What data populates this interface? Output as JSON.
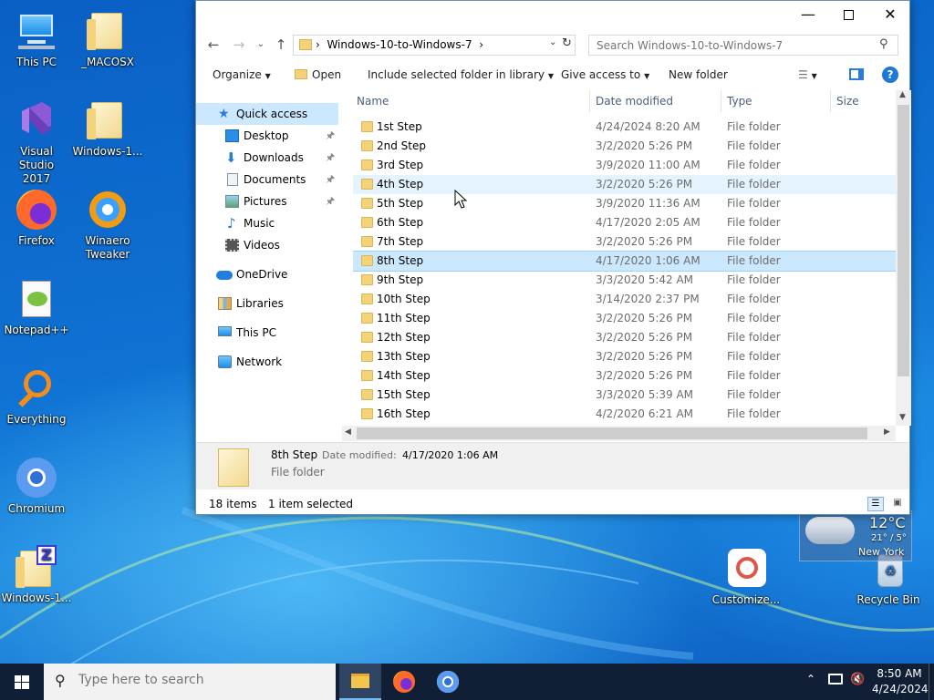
{
  "desktop": {
    "icons": [
      {
        "label": "This PC"
      },
      {
        "label": "_MACOSX"
      },
      {
        "label": "Visual Studio 2017"
      },
      {
        "label": "Windows-1..."
      },
      {
        "label": "Firefox"
      },
      {
        "label": "Winaero Tweaker"
      },
      {
        "label": "Notepad++"
      },
      {
        "label": "Everything"
      },
      {
        "label": "Chromium"
      },
      {
        "label": "Windows-1..."
      },
      {
        "label": "Customize..."
      },
      {
        "label": "Recycle Bin"
      }
    ],
    "weather": {
      "temp": "12°C",
      "range": "21° / 5°",
      "city": "New York"
    }
  },
  "explorer": {
    "address": {
      "path": "Windows-10-to-Windows-7",
      "search_placeholder": "Search Windows-10-to-Windows-7"
    },
    "toolbar": {
      "organize": "Organize",
      "open": "Open",
      "include": "Include selected folder in library",
      "share": "Give access to",
      "new_folder": "New folder"
    },
    "nav": {
      "quick_access": "Quick access",
      "desktop": "Desktop",
      "downloads": "Downloads",
      "documents": "Documents",
      "pictures": "Pictures",
      "music": "Music",
      "videos": "Videos",
      "onedrive": "OneDrive",
      "libraries": "Libraries",
      "this_pc": "This PC",
      "network": "Network"
    },
    "columns": {
      "name": "Name",
      "date": "Date modified",
      "type": "Type",
      "size": "Size"
    },
    "rows": [
      {
        "name": "1st Step",
        "date": "4/24/2024 8:20 AM",
        "type": "File folder"
      },
      {
        "name": "2nd Step",
        "date": "3/2/2020 5:26 PM",
        "type": "File folder"
      },
      {
        "name": "3rd Step",
        "date": "3/9/2020 11:00 AM",
        "type": "File folder"
      },
      {
        "name": "4th Step",
        "date": "3/2/2020 5:26 PM",
        "type": "File folder"
      },
      {
        "name": "5th Step",
        "date": "3/9/2020 11:36 AM",
        "type": "File folder"
      },
      {
        "name": "6th Step",
        "date": "4/17/2020 2:05 AM",
        "type": "File folder"
      },
      {
        "name": "7th Step",
        "date": "3/2/2020 5:26 PM",
        "type": "File folder"
      },
      {
        "name": "8th Step",
        "date": "4/17/2020 1:06 AM",
        "type": "File folder"
      },
      {
        "name": "9th Step",
        "date": "3/3/2020 5:42 AM",
        "type": "File folder"
      },
      {
        "name": "10th Step",
        "date": "3/14/2020 2:37 PM",
        "type": "File folder"
      },
      {
        "name": "11th Step",
        "date": "3/2/2020 5:26 PM",
        "type": "File folder"
      },
      {
        "name": "12th Step",
        "date": "3/2/2020 5:26 PM",
        "type": "File folder"
      },
      {
        "name": "13th Step",
        "date": "3/2/2020 5:26 PM",
        "type": "File folder"
      },
      {
        "name": "14th Step",
        "date": "3/2/2020 5:26 PM",
        "type": "File folder"
      },
      {
        "name": "15th Step",
        "date": "3/3/2020 5:39 AM",
        "type": "File folder"
      },
      {
        "name": "16th Step",
        "date": "4/2/2020 6:21 AM",
        "type": "File folder"
      }
    ],
    "details": {
      "name": "8th Step",
      "date_label": "Date modified:",
      "date": "4/17/2020 1:06 AM",
      "type": "File folder"
    },
    "status": {
      "items": "18 items",
      "selected": "1 item selected"
    }
  },
  "taskbar": {
    "search_placeholder": "Type here to search",
    "time": "8:50 AM",
    "date": "4/24/2024"
  }
}
